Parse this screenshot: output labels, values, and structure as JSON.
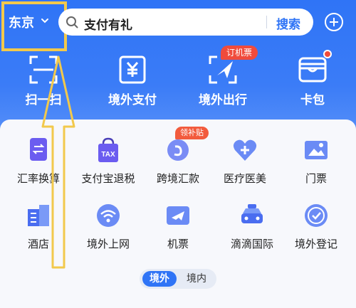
{
  "header": {
    "city": "东京",
    "search_value": "支付有礼",
    "search_button": "搜索"
  },
  "quick_actions": [
    {
      "label": "扫一扫"
    },
    {
      "label": "境外支付"
    },
    {
      "label": "境外出行",
      "badge": "订机票"
    },
    {
      "label": "卡包"
    }
  ],
  "services": [
    {
      "label": "汇率换算"
    },
    {
      "label": "支付宝退税",
      "icon_text": "TAX"
    },
    {
      "label": "跨境汇款",
      "badge": "领补贴"
    },
    {
      "label": "医疗医美"
    },
    {
      "label": "门票"
    },
    {
      "label": "酒店"
    },
    {
      "label": "境外上网"
    },
    {
      "label": "机票"
    },
    {
      "label": "滴滴国际"
    },
    {
      "label": "境外登记"
    }
  ],
  "region_toggle": {
    "selected": "境外",
    "other": "境内"
  },
  "colors": {
    "header_blue": "#2f74f6",
    "highlight_yellow": "#f2c94c",
    "badge_red": "#f04b3c"
  }
}
